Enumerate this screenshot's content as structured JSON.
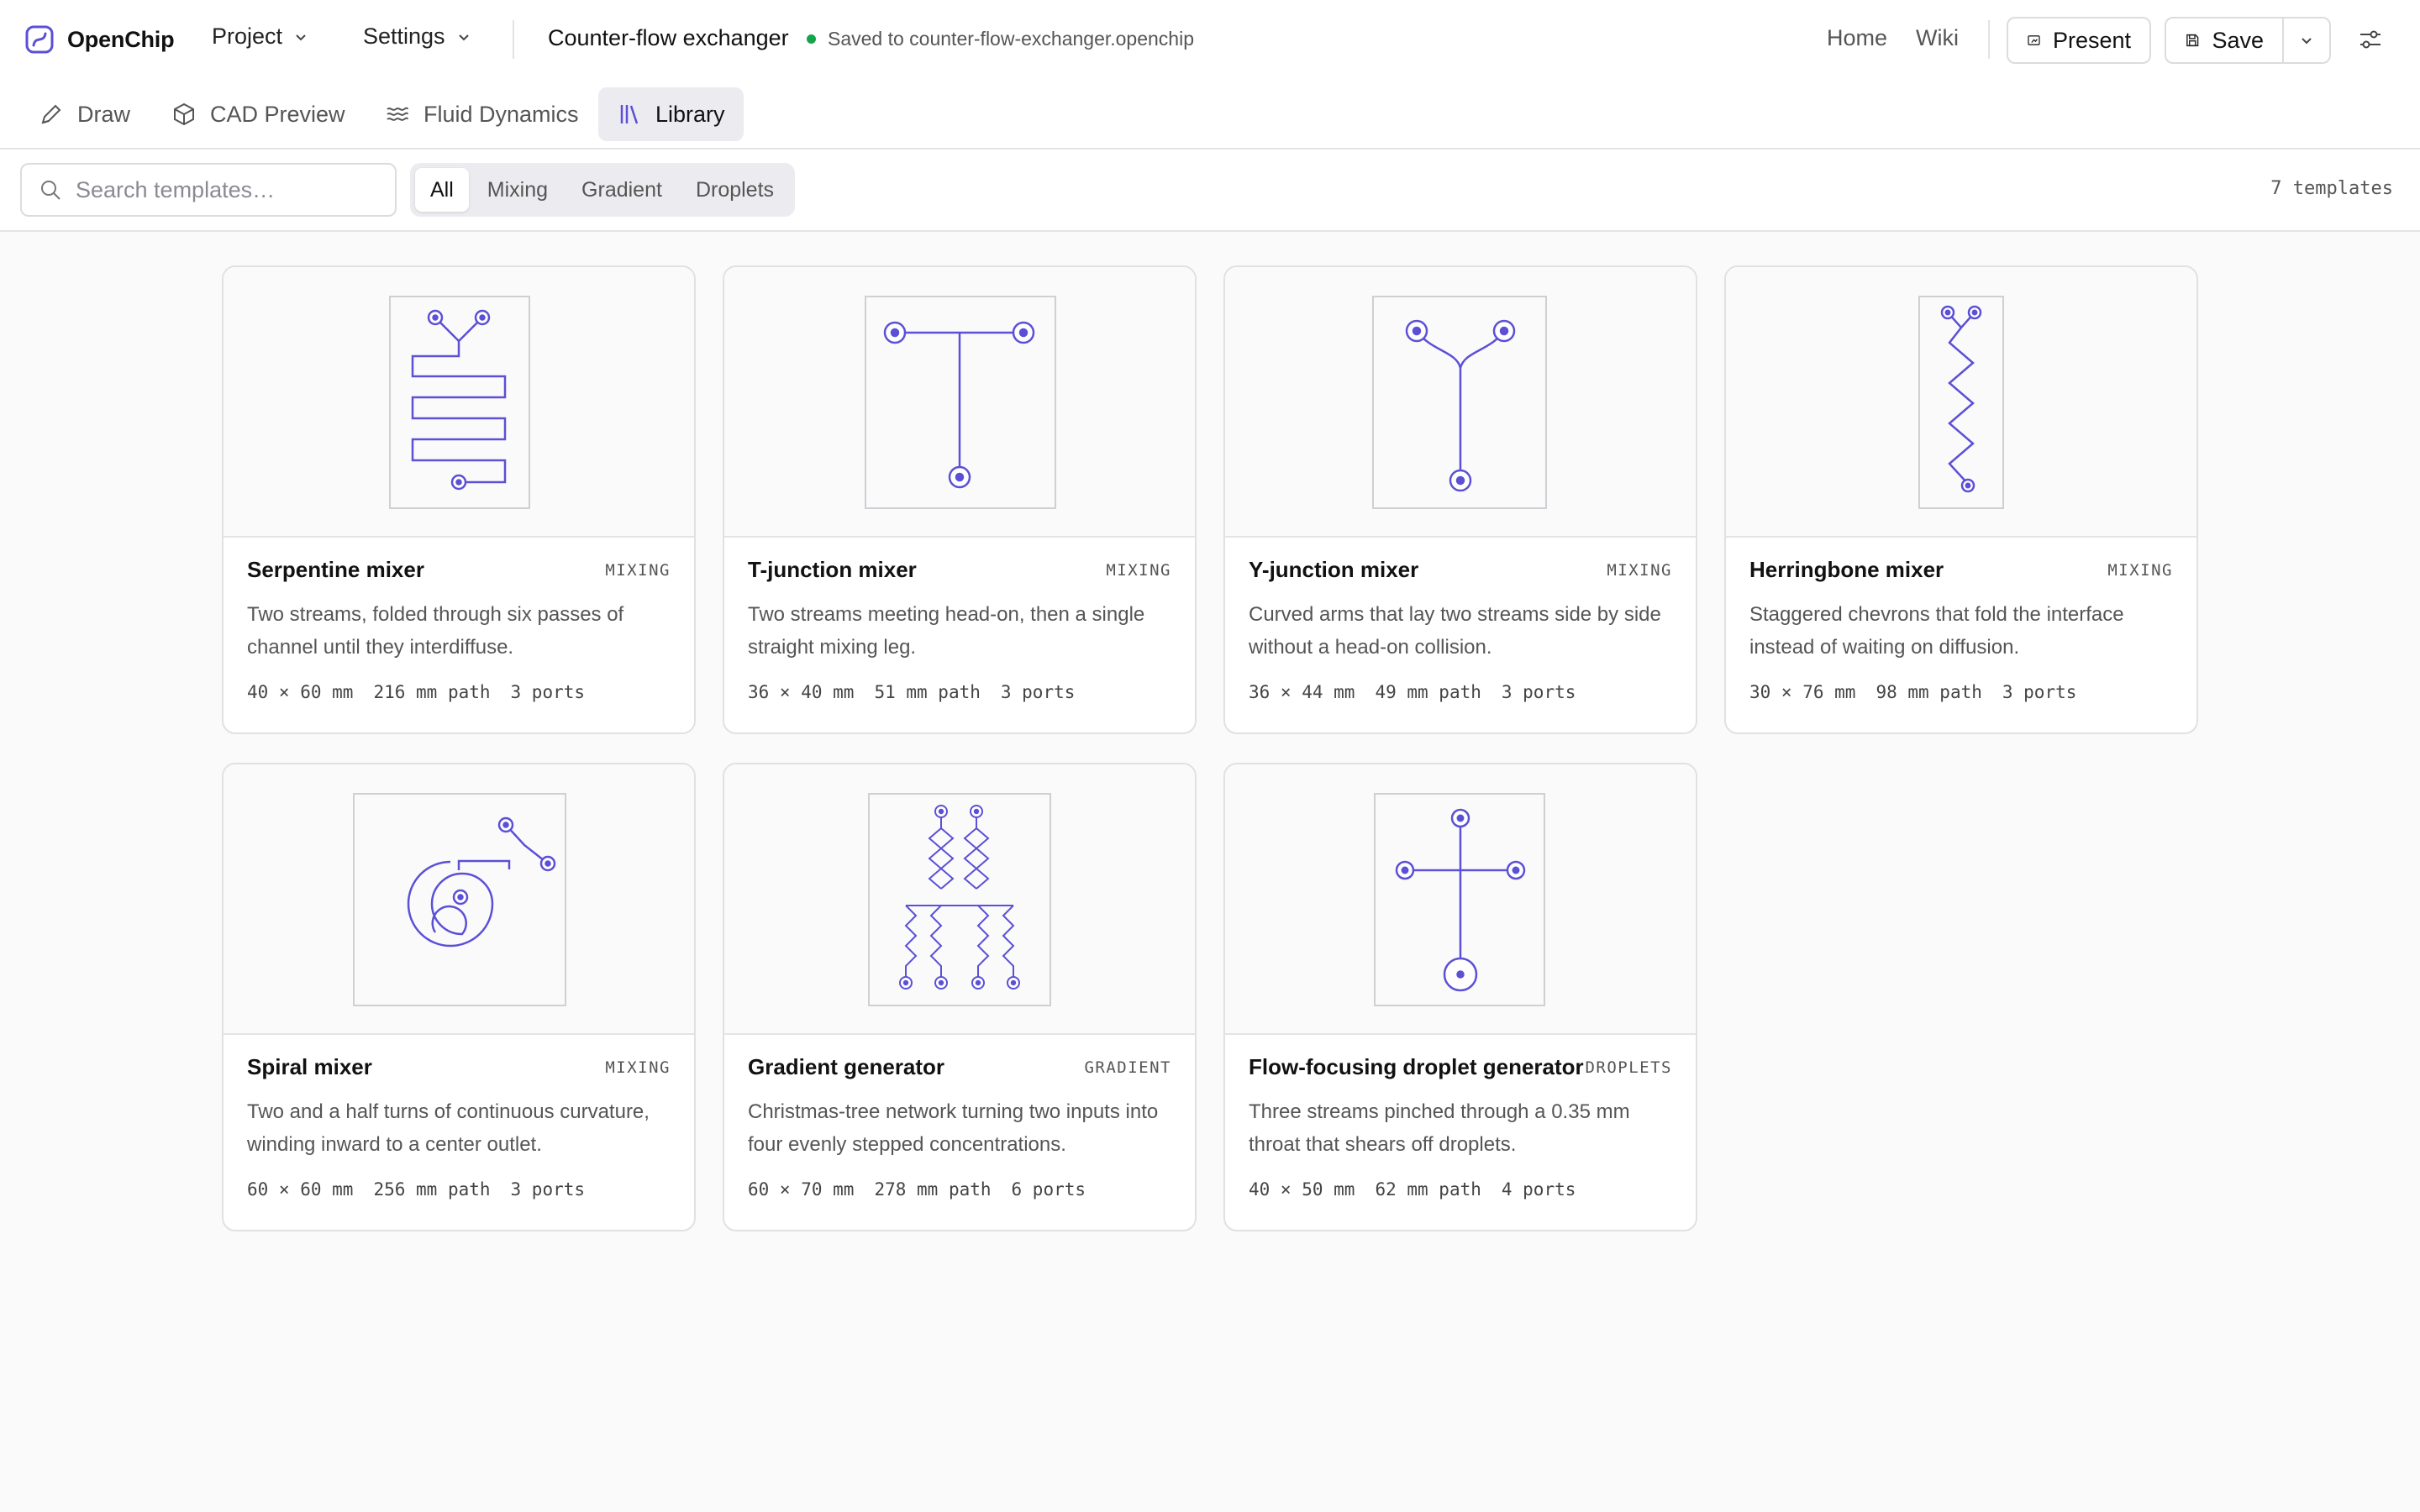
{
  "app": {
    "name": "OpenChip",
    "accent": "#5b50d6"
  },
  "menus": {
    "project": "Project",
    "settings": "Settings"
  },
  "document": {
    "title": "Counter-flow exchanger",
    "saved_status": "Saved to counter-flow-exchanger.openchip"
  },
  "nav": {
    "home": "Home",
    "wiki": "Wiki"
  },
  "actions": {
    "present": "Present",
    "save": "Save"
  },
  "tabs": [
    {
      "label": "Draw",
      "icon": "pencil-icon"
    },
    {
      "label": "CAD Preview",
      "icon": "cube-icon"
    },
    {
      "label": "Fluid Dynamics",
      "icon": "waves-icon"
    },
    {
      "label": "Library",
      "icon": "books-icon",
      "active": true
    }
  ],
  "search": {
    "placeholder": "Search templates…",
    "value": ""
  },
  "filters": [
    {
      "label": "All",
      "active": true
    },
    {
      "label": "Mixing"
    },
    {
      "label": "Gradient"
    },
    {
      "label": "Droplets"
    }
  ],
  "template_count": "7 templates",
  "templates": [
    {
      "name": "Serpentine mixer",
      "category": "MIXING",
      "description": "Two streams, folded through six passes of channel until they interdiffuse.",
      "size": "40 × 60 mm",
      "path": "216 mm path",
      "ports": "3 ports"
    },
    {
      "name": "T-junction mixer",
      "category": "MIXING",
      "description": "Two streams meeting head-on, then a single straight mixing leg.",
      "size": "36 × 40 mm",
      "path": "51 mm path",
      "ports": "3 ports"
    },
    {
      "name": "Y-junction mixer",
      "category": "MIXING",
      "description": "Curved arms that lay two streams side by side without a head-on collision.",
      "size": "36 × 44 mm",
      "path": "49 mm path",
      "ports": "3 ports"
    },
    {
      "name": "Herringbone mixer",
      "category": "MIXING",
      "description": "Staggered chevrons that fold the interface instead of waiting on diffusion.",
      "size": "30 × 76 mm",
      "path": "98 mm path",
      "ports": "3 ports"
    },
    {
      "name": "Spiral mixer",
      "category": "MIXING",
      "description": "Two and a half turns of continuous curvature, winding inward to a center outlet.",
      "size": "60 × 60 mm",
      "path": "256 mm path",
      "ports": "3 ports"
    },
    {
      "name": "Gradient generator",
      "category": "GRADIENT",
      "description": "Christmas-tree network turning two inputs into four evenly stepped concentrations.",
      "size": "60 × 70 mm",
      "path": "278 mm path",
      "ports": "6 ports"
    },
    {
      "name": "Flow-focusing droplet generator",
      "category": "DROPLETS",
      "description": "Three streams pinched through a 0.35 mm throat that shears off droplets.",
      "size": "40 × 50 mm",
      "path": "62 mm path",
      "ports": "4 ports"
    }
  ]
}
